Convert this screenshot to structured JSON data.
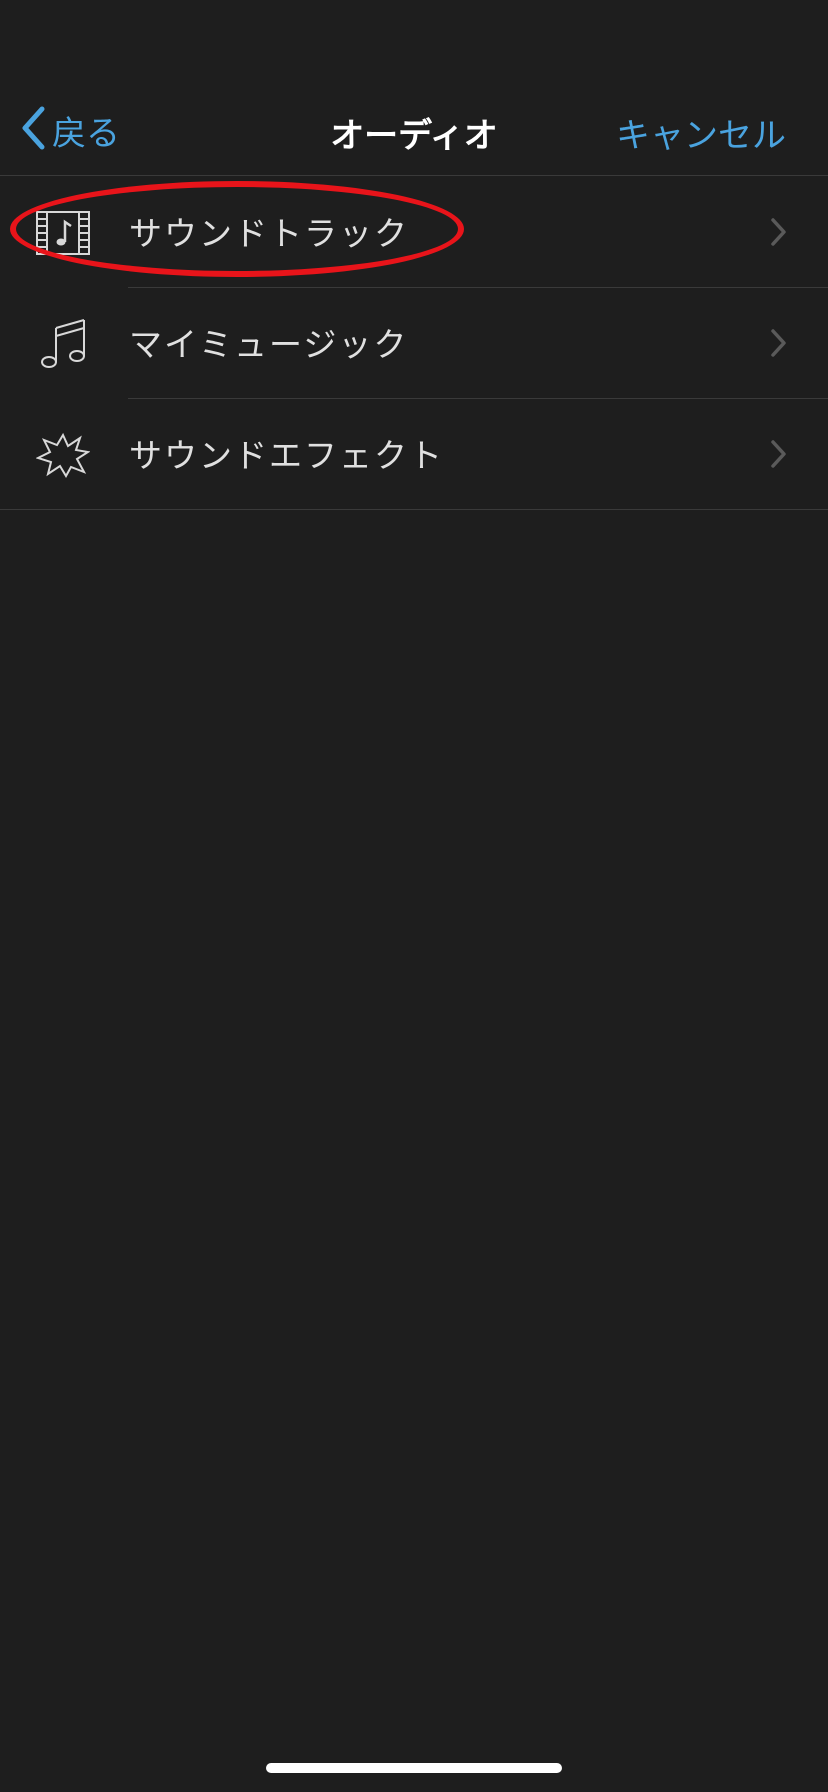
{
  "colors": {
    "accent": "#4aa3df",
    "highlight": "#e8141a"
  },
  "nav": {
    "back_label": "戻る",
    "title": "オーディオ",
    "cancel_label": "キャンセル"
  },
  "menu": [
    {
      "label": "サウンドトラック",
      "icon": "film-music-icon"
    },
    {
      "label": "マイミュージック",
      "icon": "music-note-icon"
    },
    {
      "label": "サウンドエフェクト",
      "icon": "starburst-icon"
    }
  ]
}
